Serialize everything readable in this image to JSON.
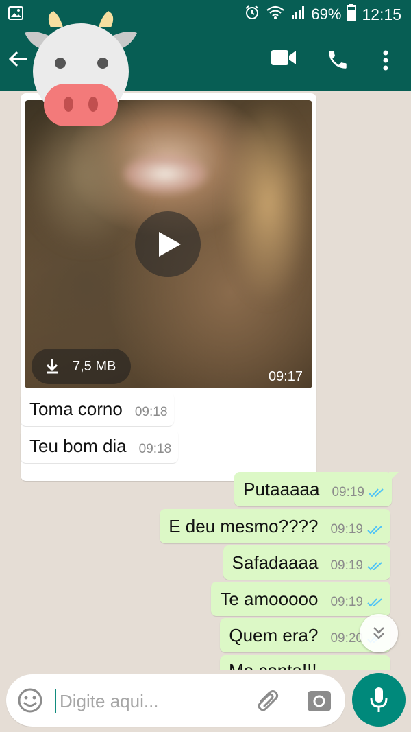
{
  "status_bar": {
    "battery": "69%",
    "time": "12:15",
    "icons": [
      "gallery-icon",
      "alarm-icon",
      "wifi-icon",
      "signal-icon",
      "battery-icon"
    ]
  },
  "header": {
    "contact_name": "",
    "icons": [
      "back-arrow-icon",
      "video-call-icon",
      "voice-call-icon",
      "more-options-icon"
    ]
  },
  "chat": {
    "video_message": {
      "file_size": "7,5 MB",
      "time": "09:17"
    },
    "incoming": [
      {
        "text": "Toma corno",
        "time": "09:18"
      },
      {
        "text": "Teu bom dia",
        "time": "09:18"
      }
    ],
    "outgoing": [
      {
        "text": "Putaaaaa",
        "time": "09:19",
        "status": "read"
      },
      {
        "text": "E deu mesmo????",
        "time": "09:19",
        "status": "read"
      },
      {
        "text": "Safadaaaa",
        "time": "09:19",
        "status": "read"
      },
      {
        "text": "Te amooooo",
        "time": "09:19",
        "status": "read"
      },
      {
        "text": "Quem era?",
        "time": "09:20",
        "status": "read"
      },
      {
        "text": "Me conta!!!",
        "time": "",
        "status": ""
      }
    ]
  },
  "input": {
    "placeholder": "Digite aqui..."
  },
  "colors": {
    "header": "#075e54",
    "chat_background": "#e5ddd5",
    "outgoing_bubble": "#dcf8c6",
    "incoming_bubble": "#ffffff",
    "mic_button": "#00897b",
    "read_ticks": "#4fc3f7"
  }
}
